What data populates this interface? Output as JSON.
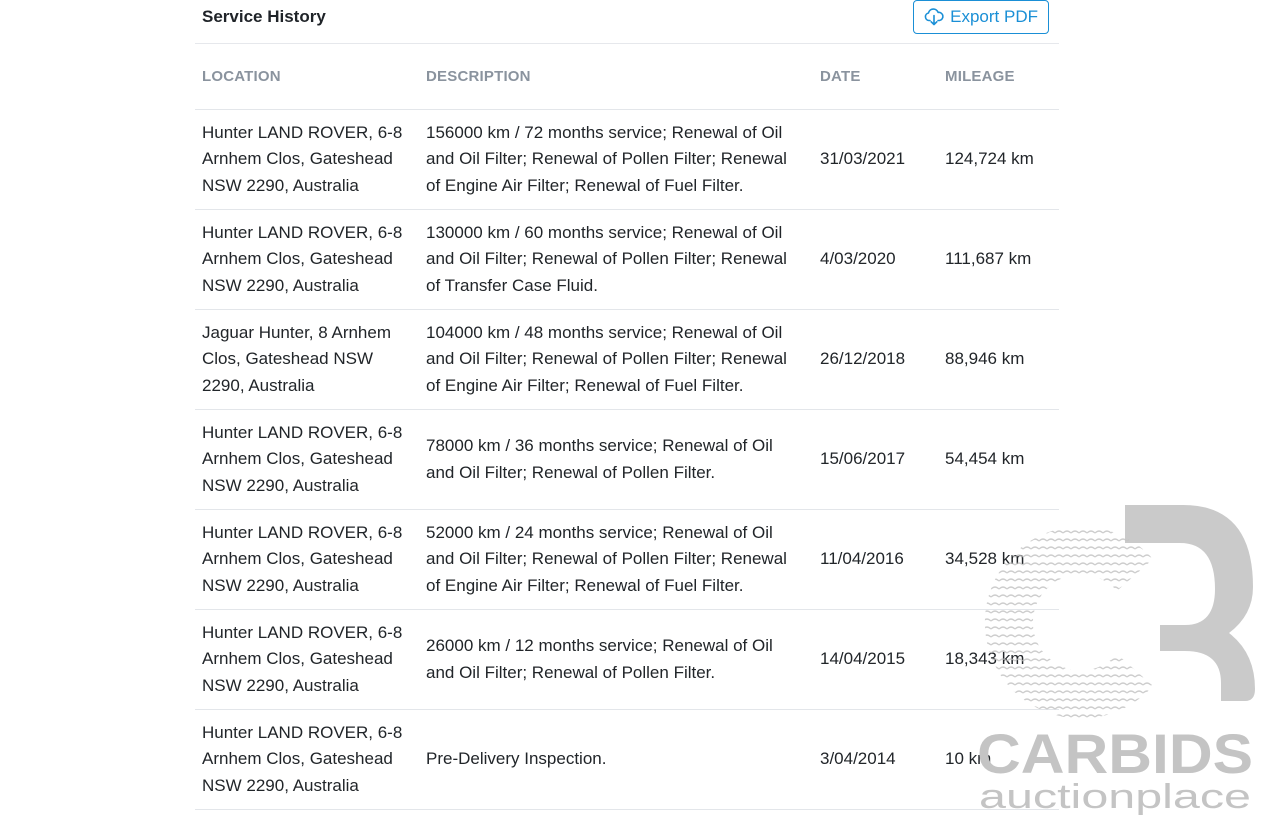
{
  "header": {
    "title": "Service History",
    "export_label": "Export PDF"
  },
  "table": {
    "columns": [
      "LOCATION",
      "DESCRIPTION",
      "DATE",
      "MILEAGE"
    ],
    "rows": [
      {
        "location": "Hunter LAND ROVER, 6-8 Arnhem Clos, Gateshead NSW 2290, Australia",
        "description": "156000 km / 72 months service; Renewal of Oil and Oil Filter; Renewal of Pollen Filter; Renewal of Engine Air Filter; Renewal of Fuel Filter.",
        "date": "31/03/2021",
        "mileage": "124,724 km"
      },
      {
        "location": "Hunter LAND ROVER, 6-8 Arnhem Clos, Gateshead NSW 2290, Australia",
        "description": "130000 km / 60 months service; Renewal of Oil and Oil Filter; Renewal of Pollen Filter; Renewal of Transfer Case Fluid.",
        "date": "4/03/2020",
        "mileage": "111,687 km"
      },
      {
        "location": "Jaguar Hunter, 8 Arnhem Clos, Gateshead NSW 2290, Australia",
        "description": "104000 km / 48 months service; Renewal of Oil and Oil Filter; Renewal of Pollen Filter; Renewal of Engine Air Filter; Renewal of Fuel Filter.",
        "date": "26/12/2018",
        "mileage": "88,946 km"
      },
      {
        "location": "Hunter LAND ROVER, 6-8 Arnhem Clos, Gateshead NSW 2290, Australia",
        "description": "78000 km / 36 months service; Renewal of Oil and Oil Filter; Renewal of Pollen Filter.",
        "date": "15/06/2017",
        "mileage": "54,454 km"
      },
      {
        "location": "Hunter LAND ROVER, 6-8 Arnhem Clos, Gateshead NSW 2290, Australia",
        "description": "52000 km / 24 months service; Renewal of Oil and Oil Filter; Renewal of Pollen Filter; Renewal of Engine Air Filter; Renewal of Fuel Filter.",
        "date": "11/04/2016",
        "mileage": "34,528 km"
      },
      {
        "location": "Hunter LAND ROVER, 6-8 Arnhem Clos, Gateshead NSW 2290, Australia",
        "description": "26000 km / 12 months service; Renewal of Oil and Oil Filter; Renewal of Pollen Filter.",
        "date": "14/04/2015",
        "mileage": "18,343 km"
      },
      {
        "location": "Hunter LAND ROVER, 6-8 Arnhem Clos, Gateshead NSW 2290, Australia",
        "description": "Pre-Delivery Inspection.",
        "date": "3/04/2014",
        "mileage": "10 km"
      }
    ]
  },
  "watermark": {
    "brand": "CARBIDS",
    "tagline": "auctionplace"
  },
  "icons": {
    "export": "cloud-download-icon"
  },
  "colors": {
    "accent": "#1a8fd6",
    "header_text": "#8a939e",
    "border": "#e3e6ea"
  }
}
